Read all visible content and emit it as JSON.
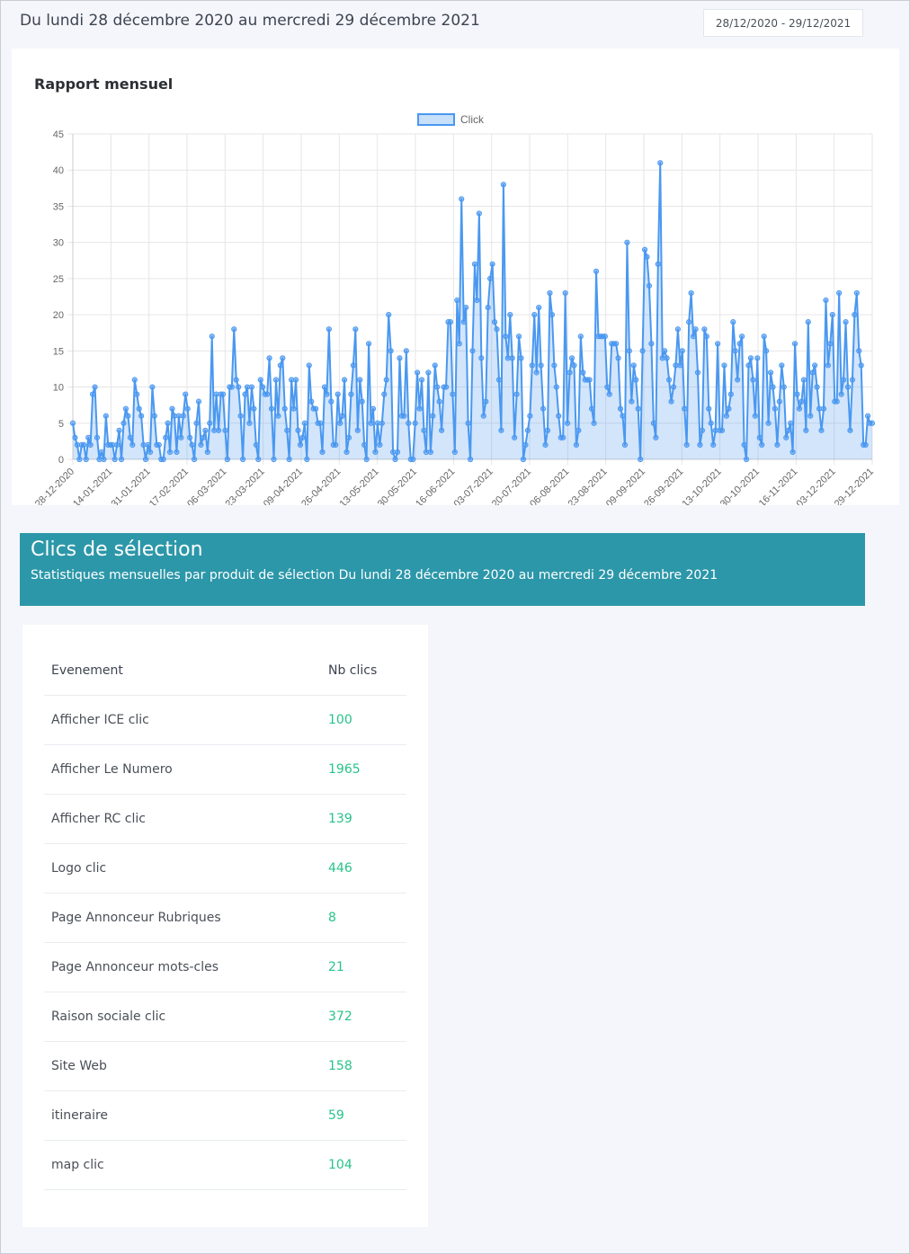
{
  "header": {
    "period_text": "Du lundi 28 décembre 2020 au mercredi 29 décembre 2021",
    "date_range_value": "28/12/2020 - 29/12/2021"
  },
  "chart_card": {
    "title": "Rapport mensuel"
  },
  "chart_data": {
    "type": "area",
    "title": "Rapport mensuel",
    "xlabel": "",
    "ylabel": "",
    "ylim": [
      0,
      45
    ],
    "yticks": [
      "0",
      "5",
      "10",
      "15",
      "20",
      "25",
      "30",
      "35",
      "40",
      "45"
    ],
    "xtick_labels": [
      "28-12-2020",
      "14-01-2021",
      "31-01-2021",
      "17-02-2021",
      "06-03-2021",
      "23-03-2021",
      "09-04-2021",
      "26-04-2021",
      "13-05-2021",
      "30-05-2021",
      "16-06-2021",
      "03-07-2021",
      "20-07-2021",
      "06-08-2021",
      "23-08-2021",
      "09-09-2021",
      "26-09-2021",
      "13-10-2021",
      "30-10-2021",
      "16-11-2021",
      "03-12-2021",
      "29-12-2021"
    ],
    "legend": "top-center",
    "grid": true,
    "series": [
      {
        "name": "Click",
        "color": "#4a98f0",
        "values": [
          5,
          3,
          2,
          0,
          2,
          2,
          0,
          3,
          2,
          9,
          10,
          3,
          0,
          1,
          0,
          6,
          2,
          2,
          2,
          0,
          2,
          4,
          0,
          5,
          7,
          6,
          3,
          2,
          11,
          9,
          7,
          6,
          2,
          0,
          2,
          1,
          10,
          6,
          2,
          2,
          0,
          0,
          3,
          5,
          1,
          7,
          6,
          1,
          6,
          3,
          6,
          9,
          7,
          3,
          2,
          0,
          5,
          8,
          2,
          3,
          4,
          1,
          5,
          17,
          4,
          9,
          4,
          9,
          9,
          4,
          0,
          10,
          10,
          18,
          11,
          10,
          6,
          0,
          9,
          10,
          5,
          10,
          7,
          2,
          0,
          11,
          10,
          9,
          9,
          14,
          7,
          0,
          11,
          6,
          13,
          14,
          7,
          4,
          0,
          11,
          7,
          11,
          4,
          2,
          3,
          5,
          0,
          13,
          8,
          7,
          7,
          5,
          5,
          1,
          10,
          9,
          18,
          8,
          2,
          2,
          9,
          5,
          6,
          11,
          1,
          3,
          9,
          13,
          18,
          4,
          11,
          8,
          2,
          0,
          16,
          5,
          7,
          1,
          5,
          2,
          5,
          9,
          11,
          20,
          15,
          1,
          0,
          1,
          14,
          6,
          6,
          15,
          5,
          0,
          0,
          5,
          12,
          7,
          11,
          4,
          1,
          12,
          1,
          6,
          13,
          10,
          8,
          4,
          10,
          10,
          19,
          19,
          9,
          1,
          22,
          16,
          36,
          19,
          21,
          5,
          0,
          15,
          27,
          22,
          34,
          14,
          6,
          8,
          21,
          25,
          27,
          19,
          18,
          11,
          4,
          38,
          17,
          14,
          20,
          14,
          3,
          9,
          17,
          14,
          0,
          2,
          4,
          6,
          13,
          20,
          12,
          21,
          13,
          7,
          2,
          4,
          23,
          20,
          13,
          10,
          6,
          3,
          3,
          23,
          5,
          12,
          14,
          13,
          2,
          4,
          17,
          12,
          11,
          11,
          11,
          7,
          5,
          26,
          17,
          17,
          17,
          17,
          10,
          9,
          16,
          16,
          16,
          14,
          7,
          6,
          2,
          30,
          15,
          8,
          13,
          11,
          7,
          0,
          15,
          29,
          28,
          24,
          16,
          5,
          3,
          27,
          41,
          14,
          15,
          14,
          11,
          8,
          10,
          13,
          18,
          13,
          15,
          7,
          2,
          19,
          23,
          17,
          18,
          12,
          2,
          4,
          18,
          17,
          7,
          5,
          2,
          4,
          16,
          4,
          4,
          13,
          6,
          7,
          9,
          19,
          15,
          11,
          16,
          17,
          2,
          0,
          13,
          14,
          11,
          6,
          14,
          3,
          2,
          17,
          15,
          5,
          12,
          10,
          7,
          2,
          8,
          13,
          10,
          3,
          4,
          5,
          1,
          16,
          9,
          7,
          8,
          11,
          4,
          19,
          6,
          12,
          13,
          10,
          7,
          4,
          7,
          22,
          13,
          16,
          20,
          8,
          8,
          23,
          9,
          11,
          19,
          10,
          4,
          11,
          20,
          23,
          15,
          13,
          2,
          2,
          6,
          5,
          5
        ]
      }
    ]
  },
  "banner": {
    "title": "Clics de sélection",
    "subtitle": "Statistiques mensuelles par produit de sélection Du lundi 28 décembre 2020 au mercredi 29 décembre 2021"
  },
  "table": {
    "headers": [
      "Evenement",
      "Nb clics"
    ],
    "rows": [
      {
        "event": "Afficher ICE clic",
        "clicks": "100"
      },
      {
        "event": "Afficher Le Numero",
        "clicks": "1965"
      },
      {
        "event": "Afficher RC clic",
        "clicks": "139"
      },
      {
        "event": "Logo clic",
        "clicks": "446"
      },
      {
        "event": "Page Annonceur Rubriques",
        "clicks": "8"
      },
      {
        "event": "Page Annonceur mots-cles",
        "clicks": "21"
      },
      {
        "event": "Raison sociale clic",
        "clicks": "372"
      },
      {
        "event": "Site Web",
        "clicks": "158"
      },
      {
        "event": "itineraire",
        "clicks": "59"
      },
      {
        "event": "map clic",
        "clicks": "104"
      }
    ]
  }
}
